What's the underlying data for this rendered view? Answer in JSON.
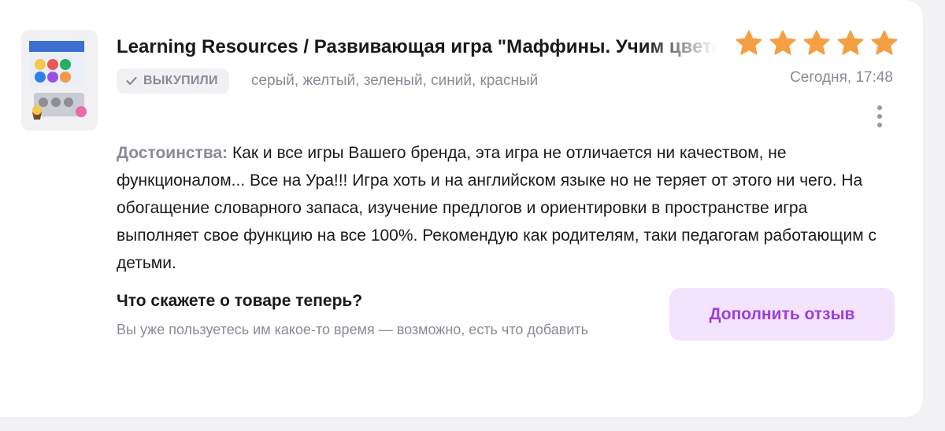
{
  "product": {
    "title": "Learning Resources / Развивающая игра \"Маффины. Учим цвета\"",
    "image_icon": "product-thumbnail-image"
  },
  "rating": {
    "stars": 5,
    "max": 5,
    "color": "#f59e42"
  },
  "purchase": {
    "badge_label": "ВЫКУПИЛИ",
    "badge_icon": "check-icon",
    "variants": "серый, желтый, зеленый, синий, красный"
  },
  "date": "Сегодня, 17:48",
  "review": {
    "label": "Достоинства:",
    "text": "Как и все игры Вашего бренда, эта игра не отличается ни качеством, не функционалом... Все на Ура!!! Игра хоть и на английском языке но не теряет от этого ни чего. На обогащение словарного запаса, изучение предлогов и ориентировки в пространстве игра выполняет свое функцию на все 100%. Рекомендую как родителям, таки педагогам работающим с детьми."
  },
  "followup": {
    "title": "Что скажете о товаре теперь?",
    "text": "Вы уже пользуетесь им какое-то время — возможно, есть что добавить",
    "button_label": "Дополнить отзыв"
  },
  "colors": {
    "accent": "#9b3fd8",
    "button_bg": "#f3e3fd",
    "muted": "#8a8a94"
  }
}
